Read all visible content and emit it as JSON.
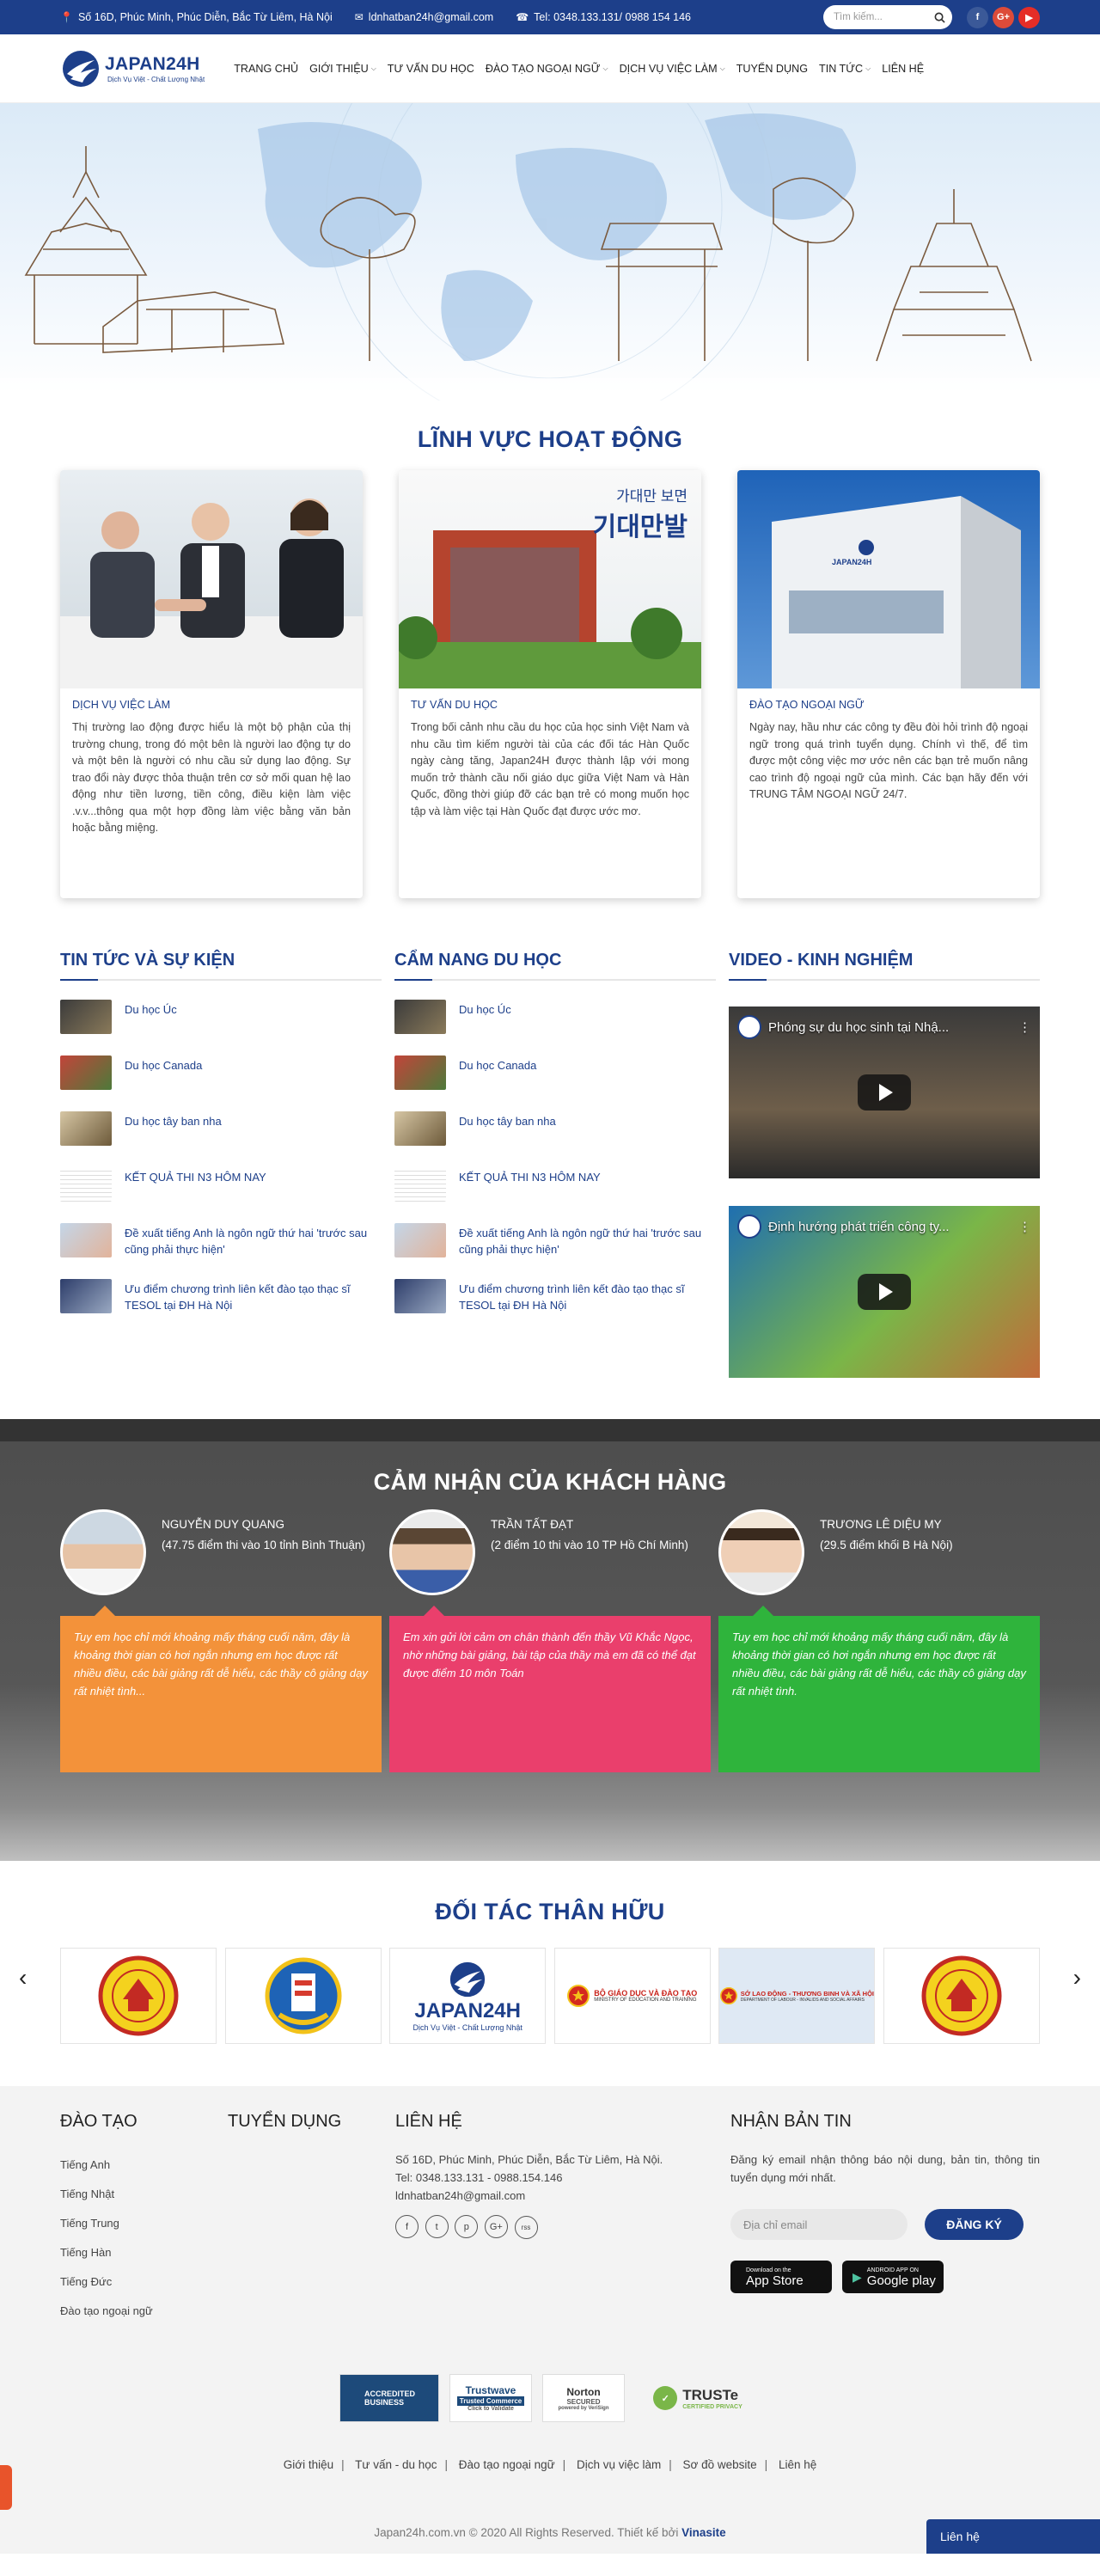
{
  "topbar": {
    "address": "Số 16D, Phúc Minh, Phúc Diễn, Bắc Từ Liêm, Hà Nội",
    "email": "ldnhatban24h@gmail.com",
    "phone": "Tel: 0348.133.131/ 0988 154 146",
    "search_placeholder": "Tìm kiếm...",
    "social": [
      "f",
      "G+",
      "▶"
    ]
  },
  "logo": {
    "name": "JAPAN24H",
    "tagline": "Dịch Vụ Việt - Chất Lượng Nhật"
  },
  "nav": [
    {
      "label": "TRANG CHỦ",
      "dropdown": false
    },
    {
      "label": "GIỚI THIỆU",
      "dropdown": true
    },
    {
      "label": "TƯ VẤN DU HỌC",
      "dropdown": false
    },
    {
      "label": "ĐÀO TẠO NGOẠI NGỮ",
      "dropdown": true
    },
    {
      "label": "DỊCH VỤ VIỆC LÀM",
      "dropdown": true
    },
    {
      "label": "TUYỂN DỤNG",
      "dropdown": false
    },
    {
      "label": "TIN TỨC",
      "dropdown": true
    },
    {
      "label": "LIÊN HỆ",
      "dropdown": false
    }
  ],
  "services": {
    "title": "LĨNH VỰC HOẠT ĐỘNG",
    "cards": [
      {
        "title": "DỊCH VỤ VIỆC LÀM",
        "text": "Thị trường lao động được hiểu là một bộ phận của thị trường chung, trong đó một bên là người lao động tự do và một bên là người có nhu cầu sử dụng lao động. Sự trao đổi này được thỏa thuận trên cơ sở mối quan hệ lao động như tiền lương, tiền công, điều kiện làm việc .v.v...thông qua một hợp đồng làm việc bằng văn bản hoặc bằng miệng."
      },
      {
        "title": "TƯ VẤN DU HỌC",
        "text": "Trong bối cảnh nhu cầu du học của học sinh Việt Nam và nhu cầu tìm kiếm người tài của các đối tác Hàn Quốc ngày càng tăng, Japan24H được thành lập với mong muốn trở thành cầu nối giáo dục giữa Việt Nam và Hàn Quốc, đồng thời giúp đỡ các bạn trẻ có mong muốn học tập và làm việc tại Hàn Quốc đạt được ước mơ.",
        "image_text1": "가대만 보면",
        "image_text2": "기대만발"
      },
      {
        "title": "ĐÀO TẠO NGOẠI NGỮ",
        "text": "Ngày nay, hầu như các công ty đều đòi hỏi trình độ ngoại ngữ trong quá trình tuyển dụng. Chính vì thế, để tìm được một công việc mơ ước nên các bạn trẻ muốn nâng cao trình độ ngoại ngữ của mình. Các bạn hãy đến với TRUNG TÂM NGOẠI NGỮ 24/7.",
        "image_text": "JAPAN24H"
      }
    ]
  },
  "news": {
    "title": "TIN TỨC VÀ SỰ KIỆN",
    "items": [
      "Du học Úc",
      "Du học Canada",
      "Du học tây ban nha",
      "KẾT QUẢ THI N3 HÔM NAY",
      "Đề xuất tiếng Anh là ngôn ngữ thứ hai 'trước sau cũng phải thực hiện'",
      "Ưu điểm chương trình liên kết đào tạo thạc sĩ TESOL tại ĐH Hà Nội"
    ]
  },
  "handbook": {
    "title": "CẨM NANG DU HỌC",
    "items": [
      "Du học Úc",
      "Du học Canada",
      "Du học tây ban nha",
      "KẾT QUẢ THI N3 HÔM NAY",
      "Đề xuất tiếng Anh là ngôn ngữ thứ hai 'trước sau cũng phải thực hiện'",
      "Ưu điểm chương trình liên kết đào tạo thạc sĩ TESOL tại ĐH Hà Nội"
    ]
  },
  "videos": {
    "title": "VIDEO - KINH NGHIỆM",
    "items": [
      {
        "title": "Phóng sự du học sinh tại Nhậ..."
      },
      {
        "title": "Định hướng phát triển công ty..."
      }
    ]
  },
  "testimonials": {
    "title": "CẢM NHẬN CỦA KHÁCH HÀNG",
    "items": [
      {
        "name": "NGUYỄN DUY QUANG",
        "sub": "(47.75 điểm thi vào 10 tỉnh Bình Thuận)",
        "text": "Tuy em học chỉ mới khoảng mấy tháng cuối năm, đây là khoảng thời gian có hơi ngắn nhưng em học được rất nhiều điều, các bài giảng rất dễ hiểu, các thầy cô giảng dạy rất nhiệt tình...",
        "color": "#f3923a"
      },
      {
        "name": "TRẦN TẤT ĐẠT",
        "sub": "(2 điểm 10 thi vào 10 TP Hồ Chí Minh)",
        "text": "Em xin gửi lời cảm ơn chân thành đến thầy Vũ Khắc Ngọc, nhờ những bài giảng, bài tập của thầy mà em đã có thể đạt được điểm 10 môn Toán",
        "color": "#ea3f6c"
      },
      {
        "name": "TRƯƠNG LÊ DIỆU MY",
        "sub": "(29.5 điểm khối B Hà Nội)",
        "text": "Tuy em học chỉ mới khoảng mấy tháng cuối năm, đây là khoảng thời gian có hơi ngắn nhưng em học được rất nhiều điều, các bài giảng rất dễ hiểu, các thầy cô giảng dạy rất nhiệt tình.",
        "color": "#2fb43c"
      }
    ]
  },
  "partners": {
    "title": "ĐỐI TÁC THÂN HỮU",
    "prev": "‹",
    "next": "›",
    "logos": [
      {
        "type": "seal"
      },
      {
        "type": "school"
      },
      {
        "type": "japan24h",
        "text": "JAPAN24H",
        "sub": "Dịch Vụ Việt - Chất Lượng Nhật"
      },
      {
        "type": "moet",
        "text": "BỘ GIÁO DỤC VÀ ĐÀO TẠO",
        "sub": "MINISTRY OF EDUCATION AND TRAINING"
      },
      {
        "type": "labor",
        "text": "SỞ LAO ĐỘNG - THƯƠNG BINH VÀ XÃ HỘI",
        "sub": "DEPARTMENT OF LABOUR - INVALIDS AND SOCIAL AFFAIRS"
      },
      {
        "type": "seal"
      }
    ]
  },
  "footer": {
    "training": {
      "title": "ĐÀO TẠO",
      "links": [
        "Tiếng Anh",
        "Tiếng Nhật",
        "Tiếng Trung",
        "Tiếng Hàn",
        "Tiếng Đức",
        "Đào tạo ngoại ngữ"
      ]
    },
    "recruit": {
      "title": "TUYỂN DỤNG"
    },
    "contact": {
      "title": "LIÊN HỆ",
      "address": "Số 16D, Phúc Minh, Phúc Diễn, Bắc Từ Liêm, Hà Nội.",
      "phone": "Tel: 0348.133.131 - 0988.154.146",
      "email": "ldnhatban24h@gmail.com",
      "social": [
        "f",
        "t",
        "p",
        "G+",
        "rss"
      ]
    },
    "newsletter": {
      "title": "NHẬN BẢN TIN",
      "text": "Đăng ký email nhận thông báo nội dung, bản tin, thông tin tuyển dụng mới nhất.",
      "placeholder": "Địa chỉ email",
      "button": "ĐĂNG KÝ",
      "appstore_small": "Download on the",
      "appstore": "App Store",
      "gplay_small": "ANDROID APP ON",
      "gplay": "Google play"
    },
    "badges": {
      "bbb1": "ACCREDITED",
      "bbb2": "BUSINESS",
      "trustwave1": "Trustwave",
      "trustwave2": "Trusted Commerce",
      "trustwave3": "Click to Validate",
      "norton1": "Norton",
      "norton2": "SECURED",
      "norton3": "powered by VeriSign",
      "truste1": "TRUSTe",
      "truste2": "CERTIFIED PRIVACY"
    },
    "menu": [
      "Giới thiệu",
      "Tư vấn - du học",
      "Đào tạo ngoại ngữ",
      "Dịch vụ việc làm",
      "Sơ đồ website",
      "Liên hệ"
    ],
    "copyright": "Japan24h.com.vn © 2020 All Rights Reserved. Thiết kế bởi",
    "designer": "Vinasite",
    "chat": "Liên hệ"
  }
}
